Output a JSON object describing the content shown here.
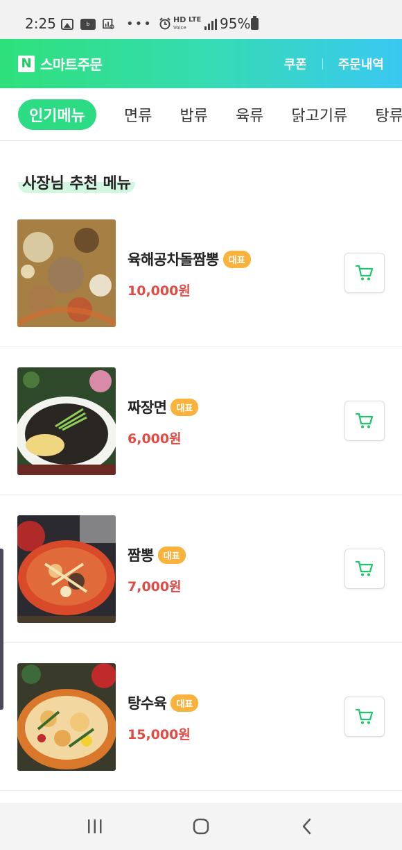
{
  "status_bar": {
    "time": "2:25",
    "battery": "95%",
    "network": "LTE"
  },
  "header": {
    "brand_logo": "N",
    "brand_name": "스마트주문",
    "coupon": "쿠폰",
    "orders": "주문내역"
  },
  "tabs": [
    {
      "label": "인기메뉴",
      "active": true
    },
    {
      "label": "면류"
    },
    {
      "label": "밥류"
    },
    {
      "label": "육류"
    },
    {
      "label": "닭고기류"
    },
    {
      "label": "탕류"
    }
  ],
  "section": {
    "title": "사장님 추천 메뉴"
  },
  "menu_items": [
    {
      "name": "육해공차돌짬뽕",
      "badge": "대표",
      "price": "10,000원",
      "image": "seafood-jjamppong-photo"
    },
    {
      "name": "짜장면",
      "badge": "대표",
      "price": "6,000원",
      "image": "jajangmyeon-photo"
    },
    {
      "name": "짬뽕",
      "badge": "대표",
      "price": "7,000원",
      "image": "jjamppong-photo"
    },
    {
      "name": "탕수육",
      "badge": "대표",
      "price": "15,000원",
      "image": "tangsuyuk-photo"
    }
  ],
  "colors": {
    "accent": "#2bdc84",
    "price": "#e24a44",
    "badge": "#f9b23b",
    "cart_icon": "#20c46a"
  },
  "icons": {
    "cart": "cart-icon",
    "nav_recent": "recent-apps-icon",
    "nav_home": "home-icon",
    "nav_back": "back-icon"
  }
}
